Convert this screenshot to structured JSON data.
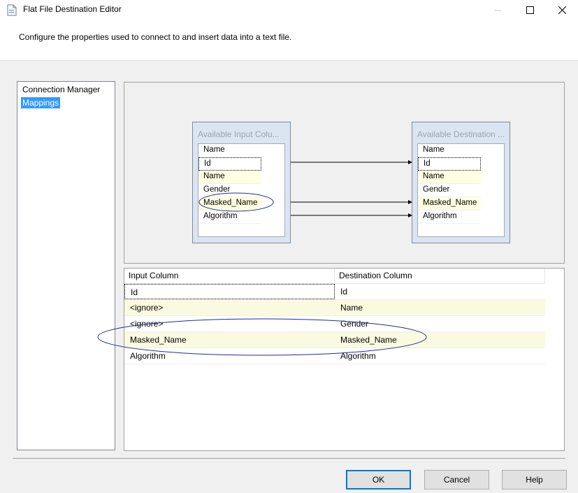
{
  "window": {
    "title": "Flat File Destination Editor",
    "icon": "document-icon"
  },
  "description": "Configure the properties used to connect to and insert data into a text file.",
  "nav": {
    "items": [
      {
        "label": "Connection Manager",
        "selected": false
      },
      {
        "label": "Mappings",
        "selected": true
      }
    ]
  },
  "input_table": {
    "title": "Available Input Colu...",
    "columns": [
      "Name",
      "Id",
      "Name",
      "Gender",
      "Masked_Name",
      "Algorithm"
    ]
  },
  "destination_table": {
    "title": "Available Destination ...",
    "columns": [
      "Name",
      "Id",
      "Name",
      "Gender",
      "Masked_Name",
      "Algorithm"
    ]
  },
  "grid": {
    "headers": {
      "input": "Input Column",
      "destination": "Destination Column"
    },
    "rows": [
      {
        "input": "Id",
        "destination": "Id"
      },
      {
        "input": "<ignore>",
        "destination": "Name"
      },
      {
        "input": "<ignore>",
        "destination": "Gender"
      },
      {
        "input": "Masked_Name",
        "destination": "Masked_Name"
      },
      {
        "input": "Algorithm",
        "destination": "Algorithm"
      }
    ]
  },
  "buttons": {
    "ok": "OK",
    "cancel": "Cancel",
    "help": "Help"
  },
  "colors": {
    "selection": "#3399ff",
    "annotation": "#1f2f8f",
    "row_highlight": "#ffffe1"
  }
}
